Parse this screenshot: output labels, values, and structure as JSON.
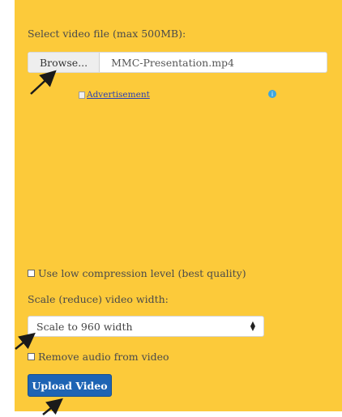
{
  "form": {
    "select_file_label": "Select video file (max 500MB):",
    "browse_label": "Browse...",
    "file_name": "MMC-Presentation.mp4",
    "low_compression_label": "Use low compression level (best quality)",
    "low_compression_checked": false,
    "scale_label": "Scale (reduce) video width:",
    "scale_selected": "Scale to 960 width",
    "remove_audio_label": "Remove audio from video",
    "remove_audio_checked": false,
    "upload_label": "Upload Video"
  },
  "ad": {
    "alt_text": "Advertisement",
    "choices_icon": "adchoices-icon"
  },
  "colors": {
    "panel_background": "#fcca3a",
    "upload_button": "#1e64b4",
    "link": "#2a3fb5"
  }
}
